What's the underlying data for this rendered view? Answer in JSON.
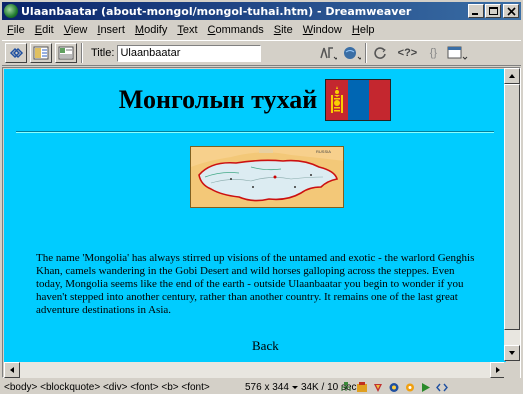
{
  "window": {
    "title": "Ulaanbaatar (about-mongol/mongol-tuhai.htm) - Dreamweaver"
  },
  "menu": [
    {
      "label": "File",
      "key": "F",
      "rest": "ile"
    },
    {
      "label": "Edit",
      "key": "E",
      "rest": "dit"
    },
    {
      "label": "View",
      "key": "V",
      "rest": "iew"
    },
    {
      "label": "Insert",
      "key": "I",
      "rest": "nsert"
    },
    {
      "label": "Modify",
      "key": "M",
      "rest": "odify"
    },
    {
      "label": "Text",
      "key": "T",
      "rest": "ext"
    },
    {
      "label": "Commands",
      "key": "C",
      "rest": "ommands"
    },
    {
      "label": "Site",
      "key": "S",
      "rest": "ite"
    },
    {
      "label": "Window",
      "key": "W",
      "rest": "indow"
    },
    {
      "label": "Help",
      "key": "H",
      "rest": "elp"
    }
  ],
  "toolbar": {
    "title_label": "Title:",
    "title_value": "Ulaanbaatar",
    "view_icons": [
      "code-view-icon",
      "split-view-icon",
      "design-view-icon"
    ],
    "tool_icons": [
      "file-management-icon",
      "preview-browser-icon",
      "refresh-icon",
      "code-navigation-icon",
      "braces-icon",
      "view-options-icon"
    ],
    "code_nav_glyph": "<?>",
    "braces_glyph": "{}"
  },
  "document": {
    "heading": "Монголын тухай",
    "background_color": "#00ccff",
    "paragraph": "The name 'Mongolia' has always stirred up visions of the untamed and exotic - the warlord Genghis Khan, camels wandering in the Gobi Desert and wild horses galloping across the steppes. Even today, Mongolia seems like the end of the earth - outside Ulaanbaatar you begin to wonder if you haven't stepped into another century, rather than another country. It remains one of the last great adventure destinations in Asia.",
    "back_link": "Back",
    "map_label": "RUSSIA",
    "flag_colors": {
      "red": "#c4272f",
      "blue": "#0066b3",
      "emblem": "#f9cf02"
    }
  },
  "statusbar": {
    "tag_selector": "<body> <blockquote> <div> <font> <b> <font>",
    "window_size": "576 x 344",
    "download": "34K / 10 sec",
    "launcher_icons": [
      "site-icon",
      "assets-icon",
      "html-styles-icon",
      "css-styles-icon",
      "behaviors-icon",
      "history-icon",
      "code-inspector-icon"
    ]
  }
}
